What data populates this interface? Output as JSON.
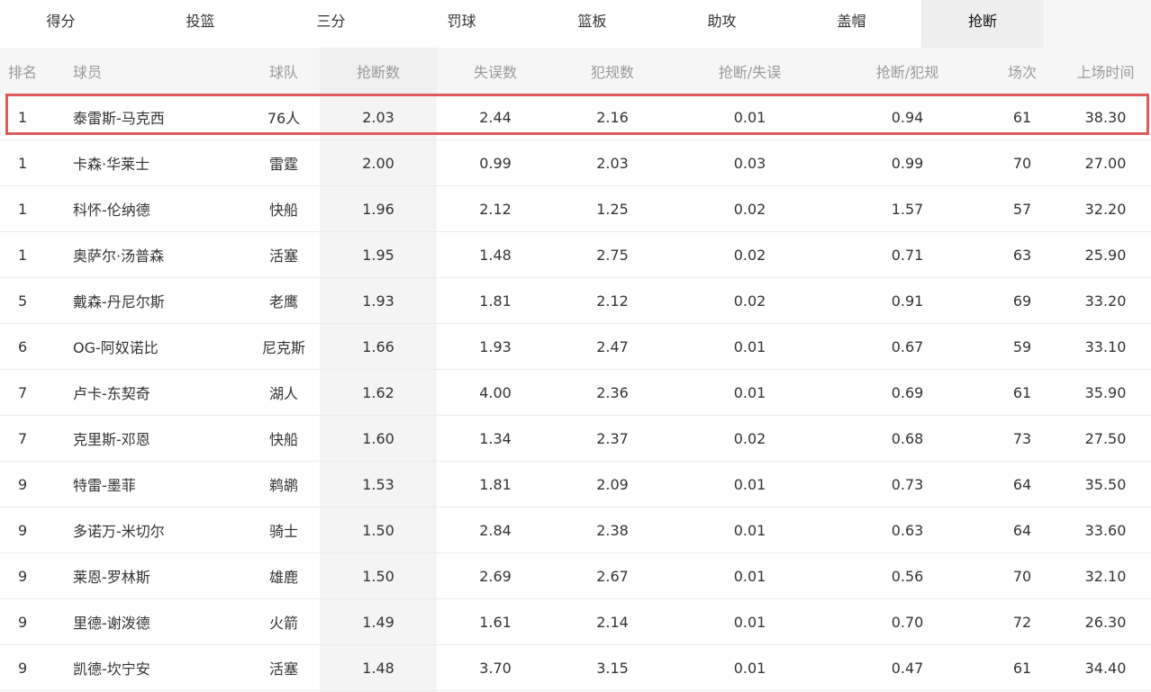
{
  "tabs": [
    {
      "label": "得分",
      "active": false
    },
    {
      "label": "投篮",
      "active": false
    },
    {
      "label": "三分",
      "active": false
    },
    {
      "label": "罚球",
      "active": false
    },
    {
      "label": "篮板",
      "active": false
    },
    {
      "label": "助攻",
      "active": false
    },
    {
      "label": "盖帽",
      "active": false
    },
    {
      "label": "抢断",
      "active": true
    }
  ],
  "table": {
    "headers": {
      "rank": "排名",
      "player": "球员",
      "team": "球队",
      "steals": "抢断数",
      "turnovers": "失误数",
      "fouls": "犯规数",
      "steal_turnover": "抢断/失误",
      "steal_foul": "抢断/犯规",
      "games": "场次",
      "minutes": "上场时间"
    },
    "rows": [
      {
        "rank": "1",
        "player": "泰雷斯-马克西",
        "team": "76人",
        "steals": "2.03",
        "turnovers": "2.44",
        "fouls": "2.16",
        "steal_turnover": "0.01",
        "steal_foul": "0.94",
        "games": "61",
        "minutes": "38.30"
      },
      {
        "rank": "1",
        "player": "卡森·华莱士",
        "team": "雷霆",
        "steals": "2.00",
        "turnovers": "0.99",
        "fouls": "2.03",
        "steal_turnover": "0.03",
        "steal_foul": "0.99",
        "games": "70",
        "minutes": "27.00"
      },
      {
        "rank": "1",
        "player": "科怀-伦纳德",
        "team": "快船",
        "steals": "1.96",
        "turnovers": "2.12",
        "fouls": "1.25",
        "steal_turnover": "0.02",
        "steal_foul": "1.57",
        "games": "57",
        "minutes": "32.20"
      },
      {
        "rank": "1",
        "player": "奥萨尔·汤普森",
        "team": "活塞",
        "steals": "1.95",
        "turnovers": "1.48",
        "fouls": "2.75",
        "steal_turnover": "0.02",
        "steal_foul": "0.71",
        "games": "63",
        "minutes": "25.90"
      },
      {
        "rank": "5",
        "player": "戴森-丹尼尔斯",
        "team": "老鹰",
        "steals": "1.93",
        "turnovers": "1.81",
        "fouls": "2.12",
        "steal_turnover": "0.02",
        "steal_foul": "0.91",
        "games": "69",
        "minutes": "33.20"
      },
      {
        "rank": "6",
        "player": "OG-阿奴诺比",
        "team": "尼克斯",
        "steals": "1.66",
        "turnovers": "1.93",
        "fouls": "2.47",
        "steal_turnover": "0.01",
        "steal_foul": "0.67",
        "games": "59",
        "minutes": "33.10"
      },
      {
        "rank": "7",
        "player": "卢卡-东契奇",
        "team": "湖人",
        "steals": "1.62",
        "turnovers": "4.00",
        "fouls": "2.36",
        "steal_turnover": "0.01",
        "steal_foul": "0.69",
        "games": "61",
        "minutes": "35.90"
      },
      {
        "rank": "7",
        "player": "克里斯-邓恩",
        "team": "快船",
        "steals": "1.60",
        "turnovers": "1.34",
        "fouls": "2.37",
        "steal_turnover": "0.02",
        "steal_foul": "0.68",
        "games": "73",
        "minutes": "27.50"
      },
      {
        "rank": "9",
        "player": "特雷-墨菲",
        "team": "鹈鹕",
        "steals": "1.53",
        "turnovers": "1.81",
        "fouls": "2.09",
        "steal_turnover": "0.01",
        "steal_foul": "0.73",
        "games": "64",
        "minutes": "35.50"
      },
      {
        "rank": "9",
        "player": "多诺万-米切尔",
        "team": "骑士",
        "steals": "1.50",
        "turnovers": "2.84",
        "fouls": "2.38",
        "steal_turnover": "0.01",
        "steal_foul": "0.63",
        "games": "64",
        "minutes": "33.60"
      },
      {
        "rank": "9",
        "player": "莱恩-罗林斯",
        "team": "雄鹿",
        "steals": "1.50",
        "turnovers": "2.69",
        "fouls": "2.67",
        "steal_turnover": "0.01",
        "steal_foul": "0.56",
        "games": "70",
        "minutes": "32.10"
      },
      {
        "rank": "9",
        "player": "里德-谢泼德",
        "team": "火箭",
        "steals": "1.49",
        "turnovers": "1.61",
        "fouls": "2.14",
        "steal_turnover": "0.01",
        "steal_foul": "0.70",
        "games": "72",
        "minutes": "26.30"
      },
      {
        "rank": "9",
        "player": "凯德-坎宁安",
        "team": "活塞",
        "steals": "1.48",
        "turnovers": "3.70",
        "fouls": "3.15",
        "steal_turnover": "0.01",
        "steal_foul": "0.47",
        "games": "61",
        "minutes": "34.40"
      }
    ]
  },
  "colors": {
    "highlight_border": "#e05a5a",
    "active_tab_bg": "#eeeeee",
    "sorted_column_bg": "#f4f4f4"
  }
}
